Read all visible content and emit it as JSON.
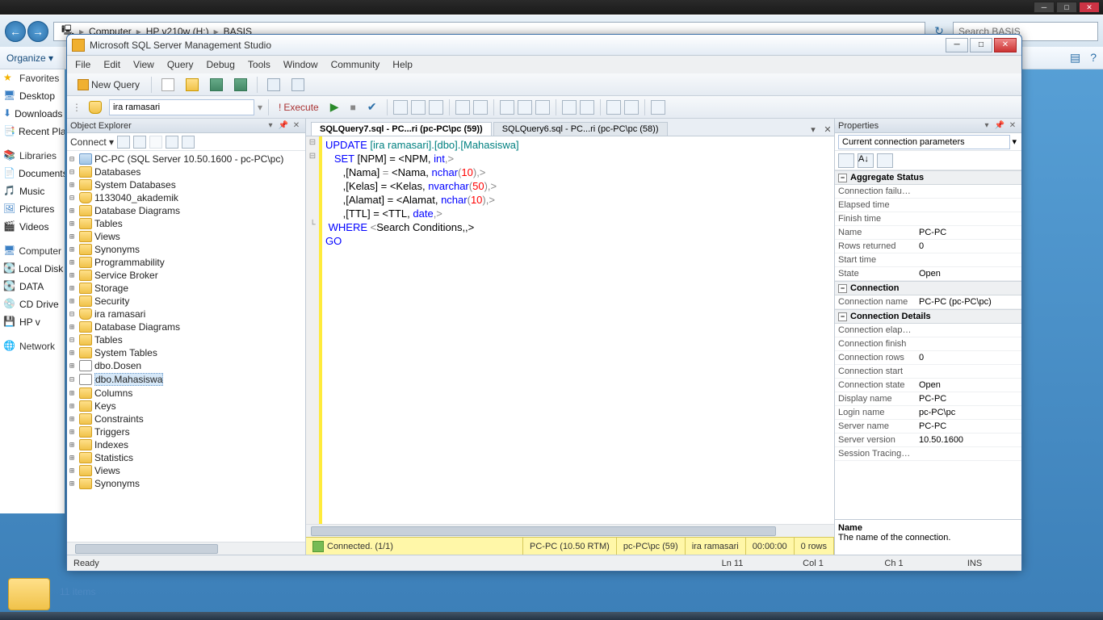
{
  "windows_chrome": {
    "breadcrumb": [
      "Computer",
      "HP v210w (H:)",
      "BASIS"
    ],
    "search_placeholder": "Search BASIS",
    "organize": "Organize ▾",
    "item_count": "11 items"
  },
  "sidebar_left": {
    "favorites": "Favorites",
    "items1": [
      "Desktop",
      "Downloads",
      "Recent Places"
    ],
    "libraries": "Libraries",
    "items2": [
      "Documents",
      "Music",
      "Pictures",
      "Videos"
    ],
    "computer": "Computer",
    "items3": [
      "Local Disk",
      "DATA",
      "CD Drive",
      "HP v"
    ],
    "network": "Network"
  },
  "ssms": {
    "title": "Microsoft SQL Server Management Studio",
    "menu": [
      "File",
      "Edit",
      "View",
      "Query",
      "Debug",
      "Tools",
      "Window",
      "Community",
      "Help"
    ],
    "new_query": "New Query",
    "db_combo": "ira ramasari",
    "execute": "Execute",
    "tabs": {
      "active": "SQLQuery7.sql - PC...ri (pc-PC\\pc (59))",
      "inactive": "SQLQuery6.sql - PC...ri (pc-PC\\pc (58))"
    },
    "objexp": {
      "title": "Object Explorer",
      "connect": "Connect ▾",
      "root": "PC-PC (SQL Server 10.50.1600 - pc-PC\\pc)",
      "databases": "Databases",
      "sysdb": "System Databases",
      "db1": "1133040_akademik",
      "db1_children": [
        "Database Diagrams",
        "Tables",
        "Views",
        "Synonyms",
        "Programmability",
        "Service Broker",
        "Storage",
        "Security"
      ],
      "db2": "ira ramasari",
      "db2_dd": "Database Diagrams",
      "db2_tables": "Tables",
      "systables": "System Tables",
      "dosen": "dbo.Dosen",
      "mhs": "dbo.Mahasiswa",
      "mhs_children": [
        "Columns",
        "Keys",
        "Constraints",
        "Triggers",
        "Indexes",
        "Statistics"
      ],
      "views": "Views",
      "synonyms": "Synonyms"
    },
    "sql": {
      "l1a": "UPDATE ",
      "l1b": "[ira ramasari].[dbo].[Mahasiswa]",
      "l2a": "   SET ",
      "l2b": "[NPM] = <",
      "l2c": "NPM, ",
      "l2d": "int",
      "l2e": ",>",
      "l3a": "      ,[Nama] ",
      "l3b": "= ",
      "l3c": "<Nama, ",
      "l3d": "nchar",
      "l3e": "(",
      "l3f": "10",
      "l3g": "),>",
      "l4a": "      ,[Kelas] = <Kelas, ",
      "l4b": "nvarchar",
      "l4c": "(",
      "l4d": "50",
      "l4e": "),>",
      "l5a": "      ,[Alamat] = <Alamat, ",
      "l5b": "nchar",
      "l5c": "(",
      "l5d": "10",
      "l5e": "),>",
      "l6a": "      ,[TTL] = <TTL, ",
      "l6b": "date",
      "l6c": ",>",
      "l7a": " WHERE ",
      "l7b": "<",
      "l7c": "Search Conditions,,>",
      "l8": "GO"
    },
    "conn_status": {
      "connected": "Connected. (1/1)",
      "server": "PC-PC (10.50 RTM)",
      "user": "pc-PC\\pc (59)",
      "db": "ira ramasari",
      "time": "00:00:00",
      "rows": "0 rows"
    },
    "props": {
      "title": "Properties",
      "subtitle": "Current connection parameters",
      "groups": {
        "agg": "Aggregate Status",
        "conn": "Connection",
        "conndet": "Connection Details"
      },
      "rows_agg": [
        [
          "Connection failures",
          ""
        ],
        [
          "Elapsed time",
          ""
        ],
        [
          "Finish time",
          ""
        ],
        [
          "Name",
          "PC-PC"
        ],
        [
          "Rows returned",
          "0"
        ],
        [
          "Start time",
          ""
        ],
        [
          "State",
          "Open"
        ]
      ],
      "rows_conn": [
        [
          "Connection name",
          "PC-PC (pc-PC\\pc)"
        ]
      ],
      "rows_conndet": [
        [
          "Connection elapsed",
          ""
        ],
        [
          "Connection finish",
          ""
        ],
        [
          "Connection rows",
          "0"
        ],
        [
          "Connection start",
          ""
        ],
        [
          "Connection state",
          "Open"
        ],
        [
          "Display name",
          "PC-PC"
        ],
        [
          "Login name",
          "pc-PC\\pc"
        ],
        [
          "Server name",
          "PC-PC"
        ],
        [
          "Server version",
          "10.50.1600"
        ],
        [
          "Session Tracing ID",
          ""
        ]
      ],
      "desc_title": "Name",
      "desc_body": "The name of the connection."
    },
    "status": {
      "ready": "Ready",
      "ln": "Ln 11",
      "col": "Col 1",
      "ch": "Ch 1",
      "ins": "INS"
    }
  }
}
